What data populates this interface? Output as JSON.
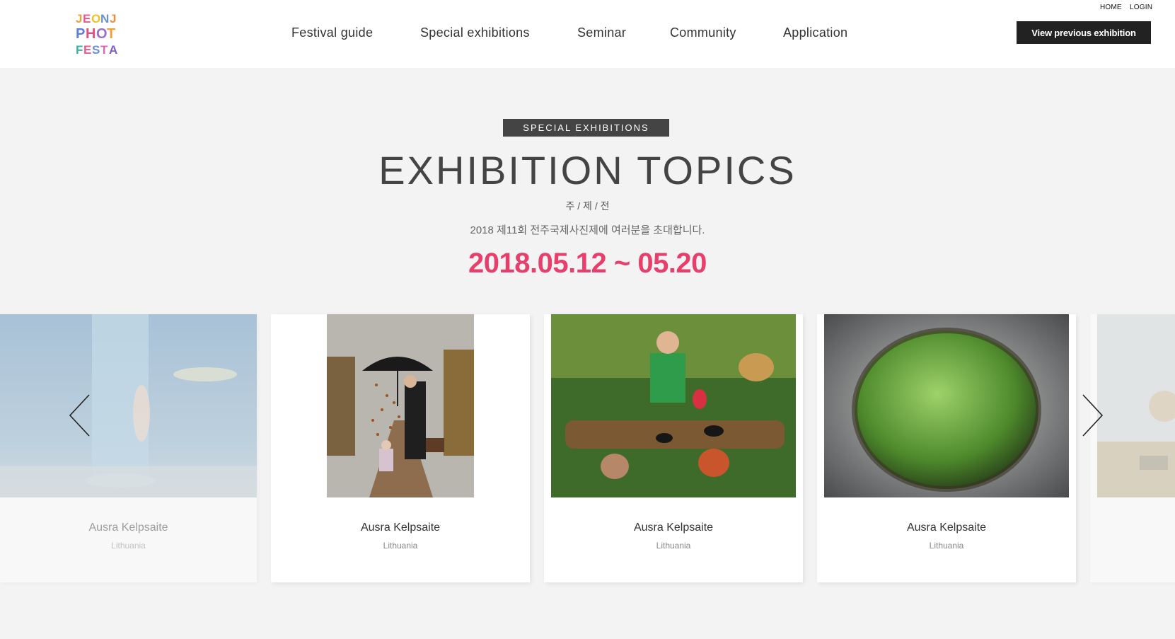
{
  "header": {
    "logo_text": "JEONJU PHOTO FESTA",
    "nav": [
      {
        "label": "Festival guide"
      },
      {
        "label": "Special exhibitions"
      },
      {
        "label": "Seminar"
      },
      {
        "label": "Community"
      },
      {
        "label": "Application"
      }
    ],
    "util": {
      "home": "HOME",
      "login": "LOGIN"
    },
    "prev_button": "View previous exhibition"
  },
  "hero": {
    "badge": "SPECIAL EXHIBITIONS",
    "title": "EXHIBITION TOPICS",
    "subtitle": "주 / 제 / 전",
    "invite": "2018 제11회 전주국제사진제에 여러분을 초대합니다.",
    "dates": "2018.05.12 ~ 05.20",
    "date_color": "#e83e6c"
  },
  "carousel": {
    "prev_icon": "chevron-left-icon",
    "next_icon": "chevron-right-icon",
    "cards": [
      {
        "name": "Ausra Kelpsaite",
        "country": "Lithuania",
        "image": "underwater-scene"
      },
      {
        "name": "Ausra Kelpsaite",
        "country": "Lithuania",
        "image": "umbrella-leaves"
      },
      {
        "name": "Ausra Kelpsaite",
        "country": "Lithuania",
        "image": "insects-log"
      },
      {
        "name": "Ausra Kelpsaite",
        "country": "Lithuania",
        "image": "green-planet"
      },
      {
        "name": "",
        "country": "",
        "image": "landscape"
      }
    ]
  }
}
